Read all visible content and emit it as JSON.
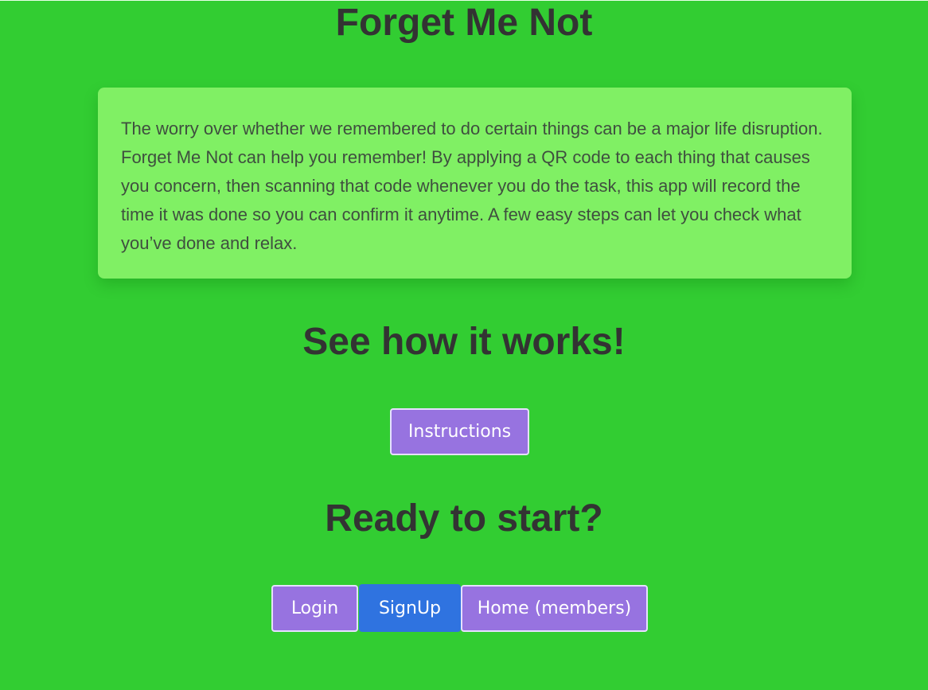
{
  "app": {
    "title": "Forget Me Not"
  },
  "intro": {
    "text": "The worry over whether we remembered to do certain things can be a major life disruption. Forget Me Not can help you remember! By applying a QR code to each thing that causes you concern, then scanning that code whenever you do the task, this app will record the time it was done so you can confirm it anytime. A few easy steps can let you check what you’ve done and relax."
  },
  "how_it_works": {
    "heading": "See how it works!",
    "instructions_label": "Instructions"
  },
  "start": {
    "heading": "Ready to start?",
    "login_label": "Login",
    "signup_label": "SignUp",
    "home_label": "Home (members)"
  },
  "colors": {
    "background": "#32cd32",
    "card": "#80f064",
    "button": "#9773e0",
    "primary_button": "#2f73e0",
    "heading_text": "#333333"
  }
}
